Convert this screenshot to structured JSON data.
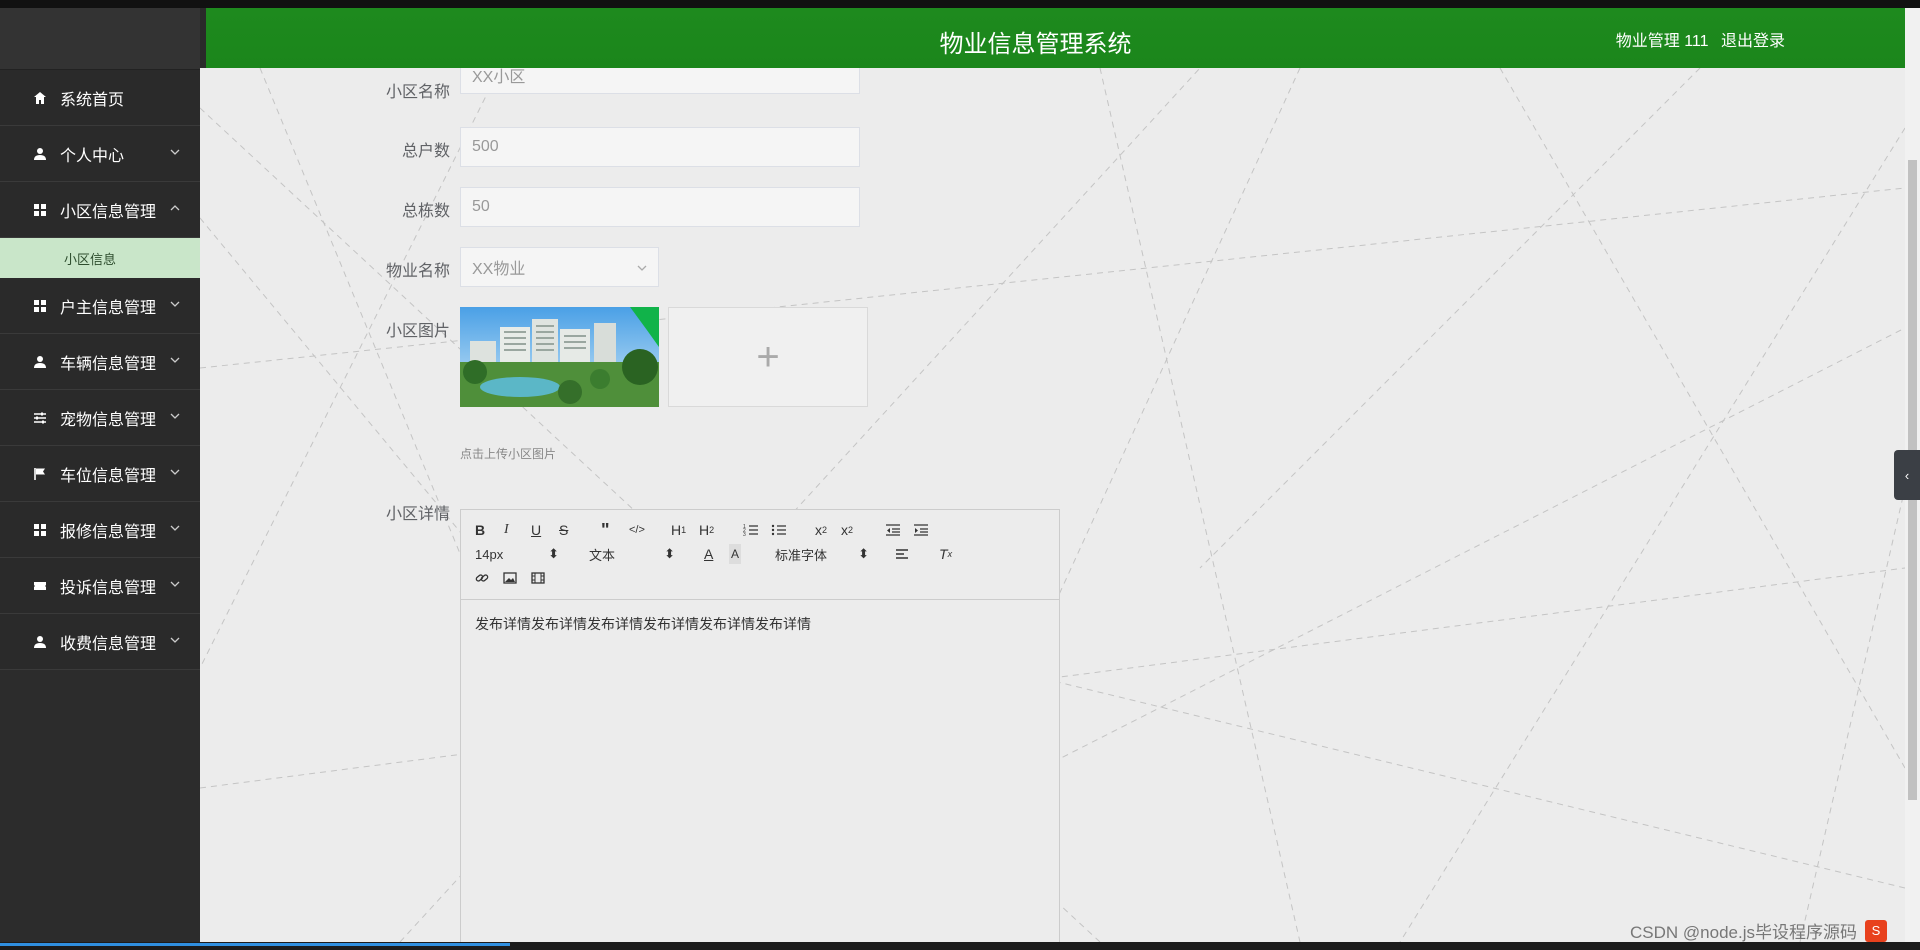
{
  "header": {
    "title": "物业信息管理系统",
    "user": "物业管理 111",
    "logout": "退出登录",
    "color": "#1e8a1e"
  },
  "sidebar": {
    "items": [
      {
        "label": "系统首页",
        "icon": "home-icon"
      },
      {
        "label": "个人中心",
        "icon": "user-icon"
      },
      {
        "label": "小区信息管理",
        "icon": "grid-icon",
        "expanded": true,
        "sub": "小区信息"
      },
      {
        "label": "户主信息管理",
        "icon": "grid-icon"
      },
      {
        "label": "车辆信息管理",
        "icon": "user-icon"
      },
      {
        "label": "宠物信息管理",
        "icon": "sliders-icon"
      },
      {
        "label": "车位信息管理",
        "icon": "flag-icon"
      },
      {
        "label": "报修信息管理",
        "icon": "grid-icon"
      },
      {
        "label": "投诉信息管理",
        "icon": "ticket-icon"
      },
      {
        "label": "收费信息管理",
        "icon": "user-icon"
      }
    ]
  },
  "form": {
    "community_name": {
      "label": "小区名称",
      "placeholder": "XX小区"
    },
    "households": {
      "label": "总户数",
      "value": "500"
    },
    "buildings": {
      "label": "总栋数",
      "value": "50"
    },
    "property_name": {
      "label": "物业名称",
      "placeholder": "XX物业"
    },
    "picture": {
      "label": "小区图片",
      "hint": "点击上传小区图片"
    },
    "details": {
      "label": "小区详情",
      "content": "发布详情发布详情发布详情发布详情发布详情发布详情"
    }
  },
  "editor": {
    "font_size": "14px",
    "paragraph": "文本",
    "font_family": "标准字体"
  },
  "watermark": {
    "text": "CSDN @node.js毕设程序源码",
    "logo": "S"
  }
}
